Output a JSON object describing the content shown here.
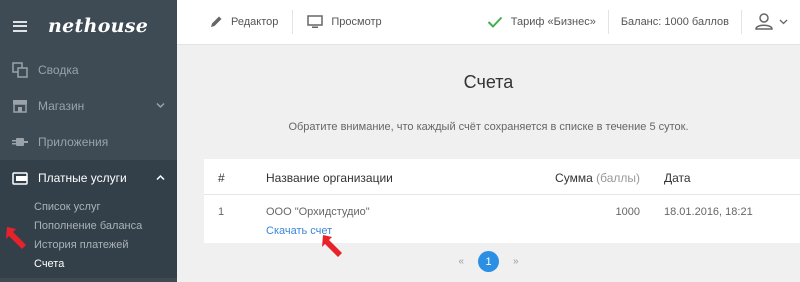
{
  "brand": {
    "logo": "nethouse"
  },
  "sidebar": {
    "items": [
      {
        "label": "Сводка",
        "icon": "squares-icon"
      },
      {
        "label": "Магазин",
        "icon": "store-icon"
      },
      {
        "label": "Приложения",
        "icon": "plug-icon"
      },
      {
        "label": "Платные услуги",
        "icon": "wallet-icon"
      }
    ],
    "subitems": [
      {
        "label": "Список услуг"
      },
      {
        "label": "Пополнение баланса"
      },
      {
        "label": "История платежей"
      },
      {
        "label": "Счета"
      }
    ]
  },
  "topbar": {
    "editor_label": "Редактор",
    "preview_label": "Просмотр",
    "tariff_label": "Тариф «Бизнес»",
    "balance_label": "Баланс: 1000 баллов"
  },
  "main": {
    "title": "Счета",
    "notice": "Обратите внимание, что каждый счёт сохраняется в списке в течение 5 суток.",
    "table": {
      "headers": {
        "num": "#",
        "org": "Название организации",
        "sum": "Сумма",
        "sum_unit": "(баллы)",
        "date": "Дата"
      },
      "rows": [
        {
          "num": "1",
          "org": "ООО \"Орхидстудио\"",
          "sum": "1000",
          "date": "18.01.2016, 18:21",
          "download": "Скачать счет"
        }
      ]
    },
    "pagination": {
      "prev": "«",
      "current": "1",
      "next": "»"
    }
  },
  "colors": {
    "sidebar": "#3e4a54",
    "accent": "#2b8fe3",
    "link": "#3b86d8",
    "annotation": "#e8222b",
    "check": "#3fae4c"
  }
}
